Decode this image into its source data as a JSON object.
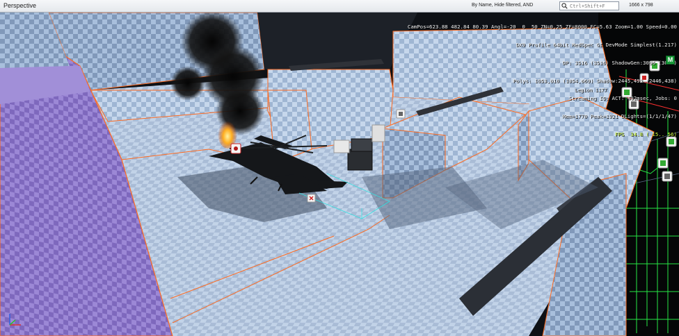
{
  "toolbar": {
    "view_mode": "Perspective",
    "filter_label": "By Name, Hide filtered, AND",
    "search_placeholder": "Ctrl+Shift+F",
    "resolution": "1666 x 798"
  },
  "debug_overlay": {
    "lines": [
      "CamPos=623.88 482.84 80.39 Angl=-20  0  50 ZN=0.25 ZF=8000 FC=5.63 Zoom=1.00 Speed=0.00",
      "DX9 Profile 64bit MedSpec GI DevMode Simplest(1.217)",
      "DP: 3516 (3516) ShadowGen:3096 (3097)",
      "Polys: 1053,010 (1054,669) Shadow:2445,492 (2446,438)",
      "Streaming IO: ACT: 402msec, Jobs: 0",
      "Mem=1770 Peak=1921 DLights=(1/1/1/47)"
    ],
    "fps": "FPS  34.8 ( 15.. 56)"
  },
  "mode_badge": "M",
  "entity_label": "Legion 1177",
  "icons": {
    "search": "search-icon",
    "axis": "axis-gizmo-icon",
    "entities": "entity-helper-icon"
  },
  "colors": {
    "selection_outline": "#ff6a1f",
    "wall_light": "#b9cde6",
    "wall_purple": "#8f7bcf",
    "fps": "#d6ff3a",
    "debug_lines": "#27e844"
  }
}
